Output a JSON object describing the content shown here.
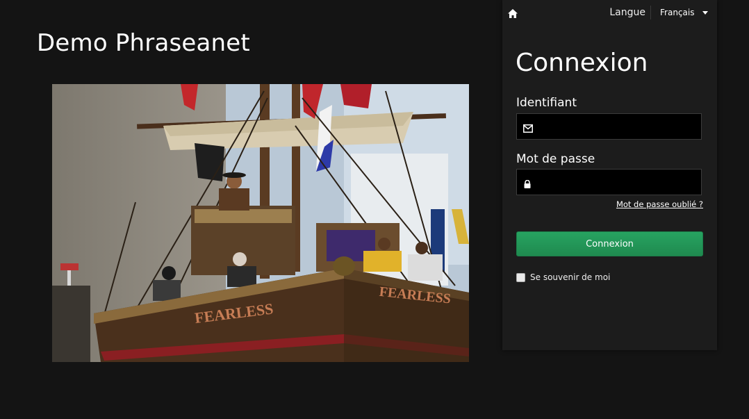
{
  "site": {
    "title": "Demo Phraseanet"
  },
  "topbar": {
    "language_label": "Langue",
    "language_selected": "Français"
  },
  "login": {
    "title": "Connexion",
    "identifier_label": "Identifiant",
    "identifier_value": "",
    "password_label": "Mot de passe",
    "password_value": "",
    "forgot_password": "Mot de passe oublié ?",
    "submit_label": "Connexion",
    "remember_label": "Se souvenir de moi",
    "remember_checked": false
  },
  "hero": {
    "hull_text_left": "FEARLESS",
    "hull_text_right": "FEARLESS"
  },
  "colors": {
    "accent": "#23955a",
    "panel": "#1c1c1c",
    "background": "#141414"
  },
  "icons": {
    "home": "home-icon",
    "email": "envelope-icon",
    "password": "lock-icon",
    "language": "caret-down-icon"
  }
}
